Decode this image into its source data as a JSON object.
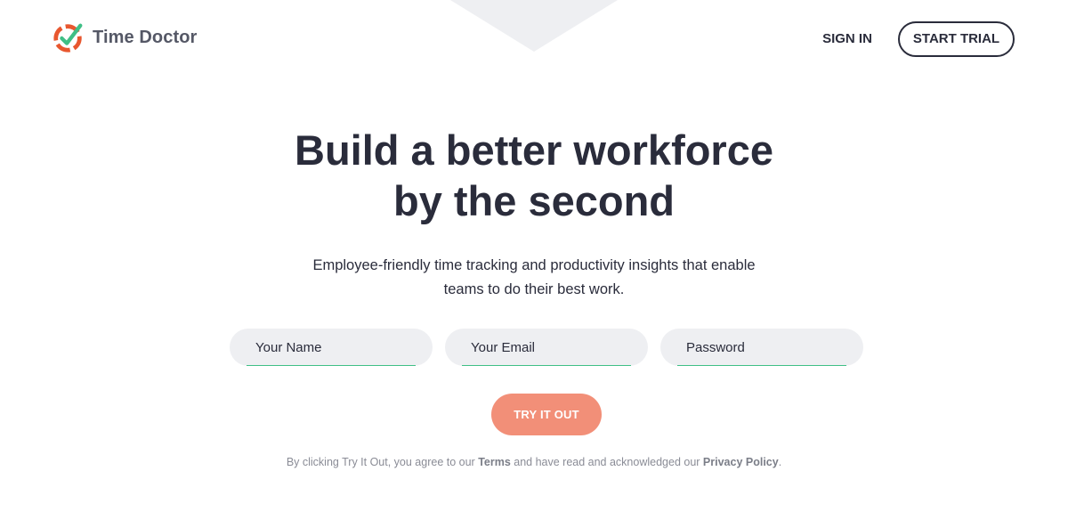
{
  "brand": {
    "name": "Time Doctor",
    "logo_icon": "clock-check-icon",
    "colors": {
      "orange": "#e8572f",
      "green": "#3fbf86",
      "dark": "#2a2c3b"
    }
  },
  "nav": {
    "sign_in": "SIGN IN",
    "start_trial": "START TRIAL"
  },
  "hero": {
    "headline_line1": "Build a better workforce",
    "headline_line2": "by the second",
    "subheadline_line1": "Employee-friendly time tracking and productivity insights that enable",
    "subheadline_line2": "teams to do their best work."
  },
  "form": {
    "name_placeholder": "Your Name",
    "email_placeholder": "Your Email",
    "password_placeholder": "Password",
    "submit_label": "TRY IT OUT",
    "submit_color": "#f28f78"
  },
  "legal": {
    "prefix": "By clicking Try It Out, you agree to our ",
    "terms_link": "Terms",
    "middle": " and have read and acknowledged our ",
    "privacy_link": "Privacy Policy",
    "suffix": "."
  }
}
